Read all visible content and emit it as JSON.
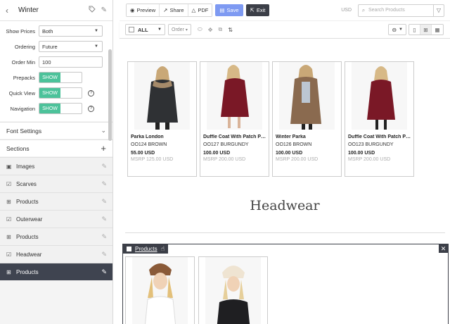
{
  "sidebar": {
    "title": "Winter",
    "settings": [
      {
        "label": "Show Prices",
        "type": "select",
        "value": "Both"
      },
      {
        "label": "Ordering",
        "type": "select",
        "value": "Future"
      },
      {
        "label": "Order Min",
        "type": "input",
        "value": "100"
      },
      {
        "label": "Prepacks",
        "type": "toggle",
        "value": "SHOW"
      },
      {
        "label": "Quick View",
        "type": "toggle",
        "value": "SHOW"
      },
      {
        "label": "Navigation",
        "type": "toggle",
        "value": "SHOW"
      }
    ],
    "font_settings_label": "Font Settings",
    "sections_label": "Sections",
    "items": [
      {
        "label": "Images",
        "icon": "image-icon"
      },
      {
        "label": "Scarves",
        "icon": "checkbox-icon"
      },
      {
        "label": "Products",
        "icon": "grid-icon"
      },
      {
        "label": "Outerwear",
        "icon": "checkbox-icon"
      },
      {
        "label": "Products",
        "icon": "grid-icon"
      },
      {
        "label": "Headwear",
        "icon": "checkbox-icon"
      },
      {
        "label": "Products",
        "icon": "grid-icon"
      }
    ],
    "active_index": 6
  },
  "toolbar": {
    "preview": "Preview",
    "share": "Share",
    "pdf": "PDF",
    "save": "Save",
    "exit": "Exit",
    "currency": "USD",
    "search_placeholder": "Search Products"
  },
  "subbar": {
    "all_label": "ALL",
    "order_label": "Order"
  },
  "products": [
    {
      "name": "Parka London",
      "code": "OO124 BROWN",
      "price": "55.00 USD",
      "msrp": "MSRP 125.00 USD"
    },
    {
      "name": "Duffle Coat With Patch Po...",
      "code": "OO127 BURGUNDY",
      "price": "100.00 USD",
      "msrp": "MSRP 200.00 USD"
    },
    {
      "name": "Winter Parka",
      "code": "OO126 BROWN",
      "price": "100.00 USD",
      "msrp": "MSRP 200.00 USD"
    },
    {
      "name": "Duffle Coat With Patch Po...",
      "code": "OO123 BURGUNDY",
      "price": "100.00 USD",
      "msrp": "MSRP 200.00 USD"
    }
  ],
  "section_title": "Headwear",
  "selected_block": {
    "label": "Products"
  },
  "colors": {
    "accent_green": "#4cc29a",
    "save_blue": "#7e9af2",
    "dark": "#3c3f48",
    "coat_dark": "#2f3134",
    "coat_burgundy": "#7a1826",
    "coat_brown": "#8a6a4f"
  }
}
